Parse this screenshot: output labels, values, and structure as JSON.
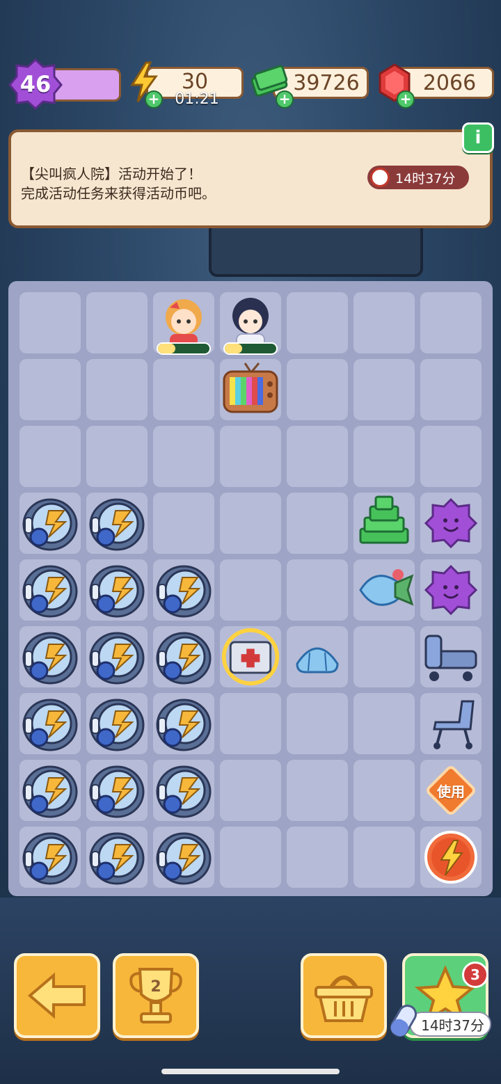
{
  "header": {
    "level": "46",
    "energy": "30",
    "energy_timer": "01:21",
    "cash": "39726",
    "gems": "2066",
    "plus_label": "+"
  },
  "banner": {
    "line1": "【尖叫疯人院】活动开始了！",
    "line2": "完成活动任务来获得活动币吧。",
    "timer": "14时37分",
    "info_label": "i"
  },
  "board": {
    "cols": 7,
    "rows": 9,
    "items": [
      {
        "r": 0,
        "c": 2,
        "icon": "girl-character-icon"
      },
      {
        "r": 0,
        "c": 3,
        "icon": "boy-character-icon"
      },
      {
        "r": 1,
        "c": 3,
        "icon": "tv-icon"
      },
      {
        "r": 3,
        "c": 0,
        "icon": "energy-generator-icon"
      },
      {
        "r": 3,
        "c": 1,
        "icon": "energy-generator-icon"
      },
      {
        "r": 3,
        "c": 5,
        "icon": "cash-stack-icon"
      },
      {
        "r": 3,
        "c": 6,
        "icon": "purple-star-icon"
      },
      {
        "r": 4,
        "c": 0,
        "icon": "energy-generator-icon"
      },
      {
        "r": 4,
        "c": 1,
        "icon": "energy-generator-icon"
      },
      {
        "r": 4,
        "c": 2,
        "icon": "energy-generator-icon"
      },
      {
        "r": 4,
        "c": 5,
        "icon": "fish-icon"
      },
      {
        "r": 4,
        "c": 6,
        "icon": "purple-star-icon"
      },
      {
        "r": 5,
        "c": 0,
        "icon": "energy-generator-icon"
      },
      {
        "r": 5,
        "c": 1,
        "icon": "energy-generator-icon"
      },
      {
        "r": 5,
        "c": 2,
        "icon": "energy-generator-icon"
      },
      {
        "r": 5,
        "c": 3,
        "icon": "medical-box-icon"
      },
      {
        "r": 5,
        "c": 4,
        "icon": "shell-icon"
      },
      {
        "r": 5,
        "c": 6,
        "icon": "hospital-bed-icon"
      },
      {
        "r": 6,
        "c": 0,
        "icon": "energy-generator-icon"
      },
      {
        "r": 6,
        "c": 1,
        "icon": "energy-generator-icon"
      },
      {
        "r": 6,
        "c": 2,
        "icon": "energy-generator-icon"
      },
      {
        "r": 6,
        "c": 6,
        "icon": "wheelchair-icon"
      },
      {
        "r": 7,
        "c": 0,
        "icon": "energy-generator-icon"
      },
      {
        "r": 7,
        "c": 1,
        "icon": "energy-generator-icon"
      },
      {
        "r": 7,
        "c": 2,
        "icon": "energy-generator-icon"
      },
      {
        "r": 7,
        "c": 6,
        "icon": "use-token-icon"
      },
      {
        "r": 8,
        "c": 0,
        "icon": "energy-generator-icon"
      },
      {
        "r": 8,
        "c": 1,
        "icon": "energy-generator-icon"
      },
      {
        "r": 8,
        "c": 2,
        "icon": "energy-generator-icon"
      },
      {
        "r": 8,
        "c": 6,
        "icon": "energy-orb-icon"
      }
    ],
    "use_token_label": "使用"
  },
  "bottom": {
    "trophy_number": "2",
    "star_badge": "3",
    "timer": "14时37分"
  },
  "colors": {
    "accent_orange": "#f6b73b",
    "accent_green": "#5cd07a",
    "purple": "#a24fd8",
    "board_bg": "#9ea4c5"
  }
}
